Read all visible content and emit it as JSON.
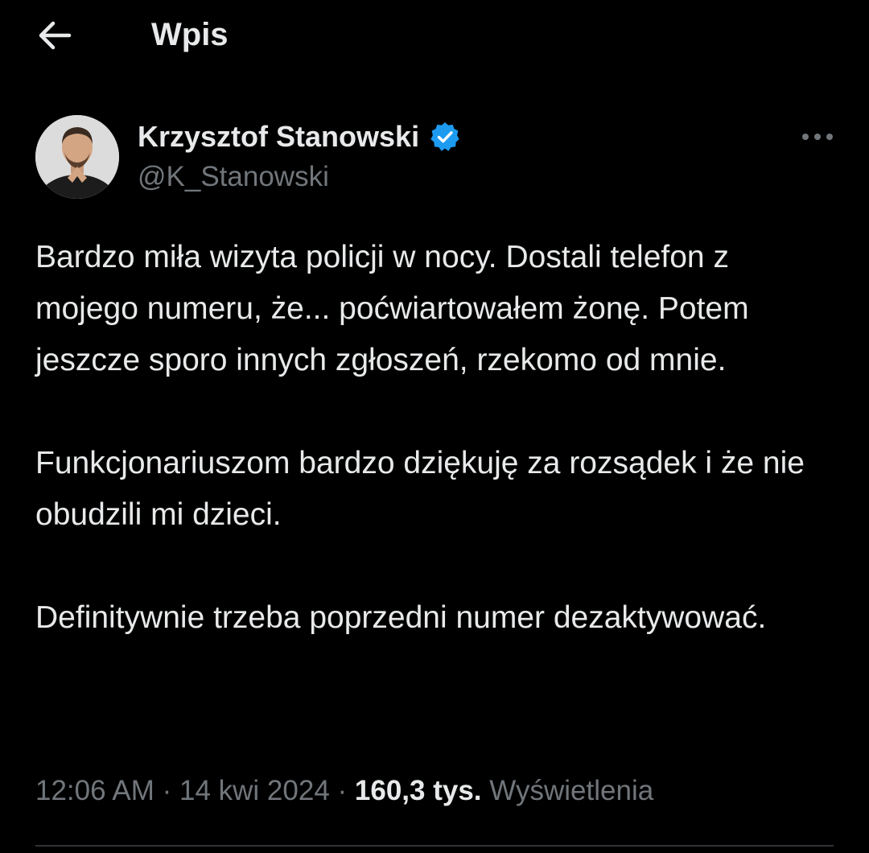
{
  "header": {
    "title": "Wpis",
    "back_icon": "arrow-left-icon"
  },
  "author": {
    "name": "Krzysztof Stanowski",
    "handle": "@K_Stanowski",
    "verified": true,
    "verified_color": "#1d9bf0"
  },
  "tweet": {
    "paragraphs": [
      "Bardzo miła wizyta policji w nocy. Dostali telefon z mojego numeru, że... poćwiartowałem żonę. Potem jeszcze sporo innych zgłoszeń, rzekomo od mnie.",
      "Funkcjonariuszom bardzo dziękuję za rozsądek i że nie obudzili mi dzieci.",
      "Definitywnie trzeba poprzedni numer dezaktywować."
    ]
  },
  "meta": {
    "time": "12:06 AM",
    "date": "14 kwi 2024",
    "separator": " · ",
    "views_count": "160,3 tys.",
    "views_label": "Wyświetlenia"
  },
  "colors": {
    "background": "#000000",
    "text": "#e7e9ea",
    "secondary": "#71767b",
    "divider": "#2f3336"
  }
}
